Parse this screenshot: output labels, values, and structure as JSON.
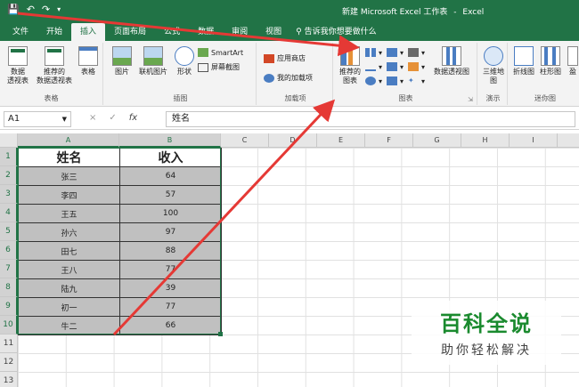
{
  "window": {
    "title": "新建 Microsoft Excel 工作表",
    "app": "Excel"
  },
  "quick_access": {
    "save_icon": "save-icon",
    "undo_icon": "undo-icon",
    "redo_icon": "redo-icon"
  },
  "tabs": [
    "文件",
    "开始",
    "插入",
    "页面布局",
    "公式",
    "数据",
    "审阅",
    "视图"
  ],
  "active_tab": "插入",
  "tell_me": "告诉我你想要做什么",
  "ribbon": {
    "tables_group": {
      "label": "表格",
      "pivot": "数据\n透视表",
      "rec_pivot": "推荐的\n数据透视表",
      "table": "表格"
    },
    "illus_group": {
      "label": "插图",
      "pictures": "图片",
      "online_pictures": "联机图片",
      "shapes": "形状",
      "smartart": "SmartArt",
      "screenshot": "屏幕截图"
    },
    "addins_group": {
      "label": "加载项",
      "store": "应用商店",
      "my_addins": "我的加载项"
    },
    "charts_group": {
      "label": "图表",
      "rec_charts": "推荐的\n图表",
      "pivot_chart": "数据透视图"
    },
    "tours_group": {
      "label": "演示",
      "map3d": "三维地\n图"
    },
    "spark_group": {
      "label": "迷你图",
      "line": "折线图",
      "column": "柱形图",
      "winloss": "盈"
    }
  },
  "formula_bar": {
    "name_box": "A1",
    "cancel": "×",
    "enter": "✓",
    "fx": "fx",
    "content": "姓名"
  },
  "columns": [
    "A",
    "B",
    "C",
    "D",
    "E",
    "F",
    "G",
    "H",
    "I",
    "J"
  ],
  "rows": [
    "1",
    "2",
    "3",
    "4",
    "5",
    "6",
    "7",
    "8",
    "9",
    "10",
    "11",
    "12",
    "13"
  ],
  "table": {
    "headers": [
      "姓名",
      "收入"
    ],
    "rows": [
      [
        "张三",
        "64"
      ],
      [
        "李四",
        "57"
      ],
      [
        "王五",
        "100"
      ],
      [
        "孙六",
        "97"
      ],
      [
        "田七",
        "88"
      ],
      [
        "王八",
        "77"
      ],
      [
        "陆九",
        "39"
      ],
      [
        "初一",
        "77"
      ],
      [
        "牛二",
        "66"
      ]
    ]
  },
  "watermark": {
    "main": "百科全说",
    "sub": "助你轻松解决"
  },
  "colors": {
    "excel_green": "#217346",
    "arrow_red": "#e53935",
    "watermark_green": "#1a8a2e"
  }
}
